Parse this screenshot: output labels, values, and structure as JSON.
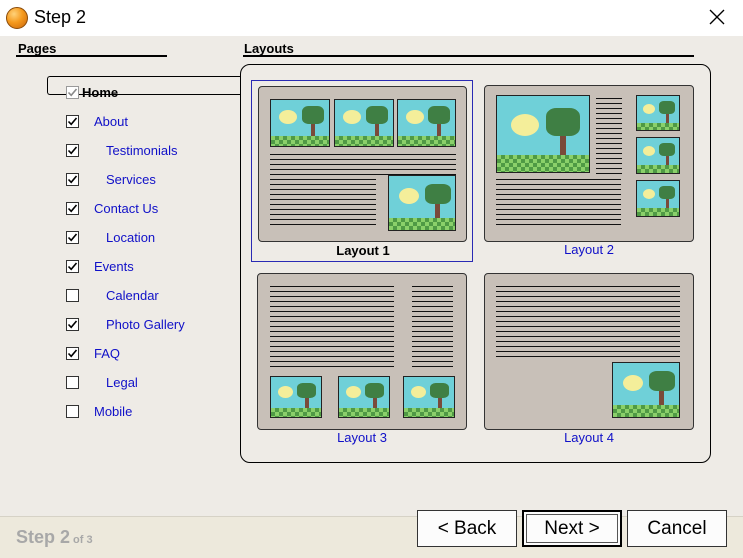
{
  "window": {
    "title": "Step 2"
  },
  "pages": {
    "heading": "Pages",
    "items": [
      {
        "label": "Home",
        "checked": true,
        "indent": 0,
        "bold": true,
        "disabled": true
      },
      {
        "label": "About",
        "checked": true,
        "indent": 0
      },
      {
        "label": "Testimonials",
        "checked": true,
        "indent": 1
      },
      {
        "label": "Services",
        "checked": true,
        "indent": 1
      },
      {
        "label": "Contact Us",
        "checked": true,
        "indent": 0
      },
      {
        "label": "Location",
        "checked": true,
        "indent": 1
      },
      {
        "label": "Events",
        "checked": true,
        "indent": 0
      },
      {
        "label": "Calendar",
        "checked": false,
        "indent": 1
      },
      {
        "label": "Photo Gallery",
        "checked": true,
        "indent": 1
      },
      {
        "label": "FAQ",
        "checked": true,
        "indent": 0
      },
      {
        "label": "Legal",
        "checked": false,
        "indent": 1
      },
      {
        "label": "Mobile",
        "checked": false,
        "indent": 0
      }
    ]
  },
  "layouts": {
    "heading": "Layouts",
    "options": [
      {
        "label": "Layout 1",
        "selected": true
      },
      {
        "label": "Layout 2",
        "selected": false
      },
      {
        "label": "Layout 3",
        "selected": false
      },
      {
        "label": "Layout 4",
        "selected": false
      }
    ]
  },
  "footer": {
    "step_label": "Step 2",
    "step_of": "of 3",
    "back_label": "< Back",
    "next_label": "Next >",
    "cancel_label": "Cancel"
  },
  "colors": {
    "link": "#1010c8",
    "panel_bg": "#eeebe6",
    "thumb_bg": "#c8c0b8",
    "sky": "#6fd0d8",
    "grass": "#4f9a45",
    "tree": "#3f7f44",
    "sun": "#f4ee9a"
  }
}
